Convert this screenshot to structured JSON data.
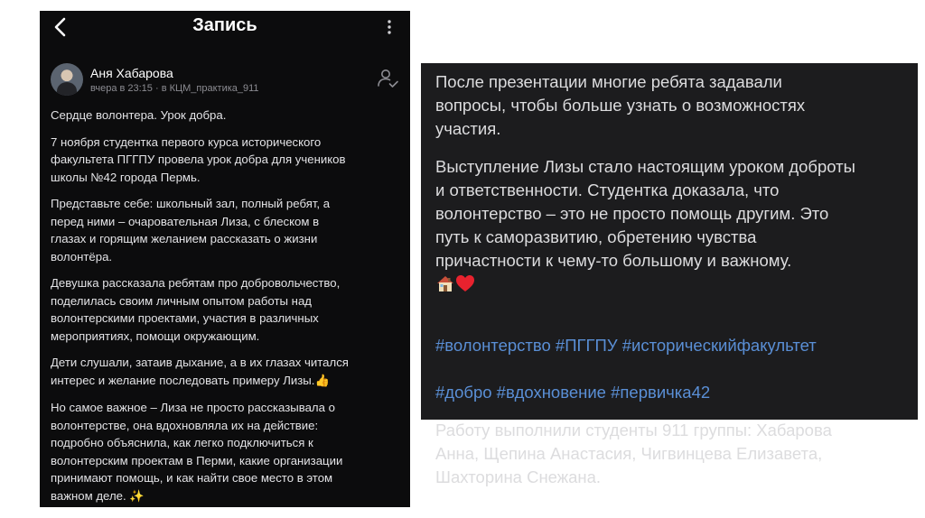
{
  "left": {
    "title": "Запись",
    "author": {
      "name": "Аня Хабарова",
      "meta": "вчера в 23:15 · в КЦМ_практика_911"
    },
    "paragraphs": [
      "Сердце волонтера. Урок добра.",
      "7 ноября  студентка  первого курса  исторического\nфакультета ПГГПУ провела урок добра для учеников\nшколы №42 города Пермь.",
      "Представьте себе: школьный зал, полный ребят, а\nперед ними – очаровательная Лиза, с блеском в\nглазах и горящим желанием рассказать о жизни\nволонтёра.",
      " Девушка рассказала ребятам про добровольчество,\nподелилась своим личным опытом работы над\nволонтерскими проектами, участия в различных\nмероприятиях, помощи окружающим.",
      " Дети слушали, затаив дыхание, а в их глазах читался\nинтерес и желание последовать примеру Лизы.",
      "Но самое важное – Лиза не просто рассказывала о\nволонтерстве, она вдохновляла их на действие:\nподробно объяснила, как легко подключиться к\nволонтерским проектам в Перми, какие организации\nпринимают помощь, и как найти свое место в этом\nважном деле. "
    ],
    "emoji_thumbs": "👍",
    "emoji_sparkles": "✨"
  },
  "right": {
    "paragraph1": "После презентации многие ребята  задавали\nвопросы, чтобы больше узнать о возможностях\nучастия.",
    "paragraph2": "Выступление Лизы стало настоящим уроком доброты\nи ответственности. Студентка доказала, что\nволонтерство – это не просто помощь другим. Это\nпуть к саморазвитию, обретению чувства\nпричастности к чему-то большому и важному.",
    "hashtags_line1": "#волонтерство #ПГГПУ #историческийфакультет",
    "hashtags_line2": "#добро #вдохновение #первичка42",
    "paragraph3": "Работу выполнили студенты 911 группы: Хабарова\nАнна, Щепина Анастасия, Чигвинцева Елизавета,\nШахторина Снежана."
  },
  "icons": {
    "back": "chevron-left-icon",
    "more": "more-vertical-icon",
    "follow": "user-check-icon",
    "home": "house-emoji-icon",
    "heart": "red-heart-emoji-icon"
  },
  "colors": {
    "left_bg": "#0c0c0d",
    "right_bg": "#1c1c1e",
    "hashtag": "#5a8fd6"
  }
}
